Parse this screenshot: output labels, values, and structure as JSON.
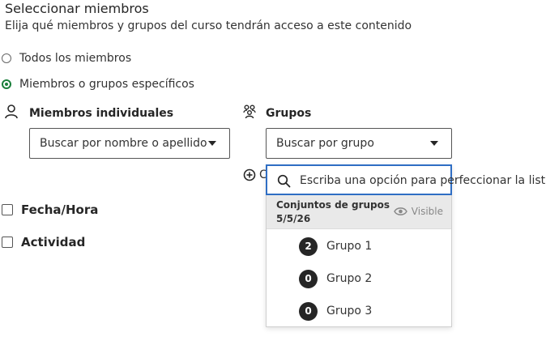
{
  "header": {
    "title": "Seleccionar miembros",
    "subtitle": "Elija qué miembros y grupos del curso tendrán acceso a este contenido"
  },
  "options": {
    "all_members": "Todos los miembros",
    "specific": "Miembros o grupos específicos",
    "selected": "specific"
  },
  "individual": {
    "label": "Miembros individuales",
    "placeholder": "Buscar por nombre o apellido"
  },
  "groups": {
    "label": "Grupos",
    "placeholder": "Buscar por grupo",
    "add_condition_partial": "C"
  },
  "conditions": {
    "date_time": "Fecha/Hora",
    "activity": "Actividad"
  },
  "dropdown": {
    "search_hint": "Escriba una opción para perfeccionar la lista.",
    "group_set_name": "Conjuntos de grupos",
    "group_set_date": "5/5/26",
    "visibility": "Visible",
    "items": [
      {
        "count": "2",
        "label": "Grupo 1"
      },
      {
        "count": "0",
        "label": "Grupo 2"
      },
      {
        "count": "0",
        "label": "Grupo 3"
      }
    ]
  },
  "colors": {
    "accent_green": "#1a7f3b",
    "focus_blue": "#2f6ec4",
    "badge_dark": "#262626"
  }
}
